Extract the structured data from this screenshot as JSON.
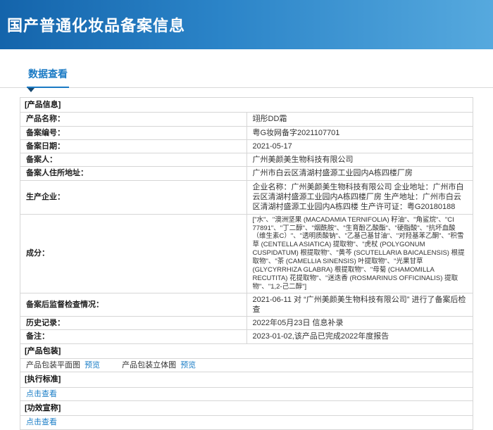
{
  "header": {
    "title": "国产普通化妆品备案信息"
  },
  "tabs": [
    {
      "label": "数据查看"
    }
  ],
  "product_info": {
    "section_title": "[产品信息]",
    "rows": [
      {
        "label": "产品名称：",
        "value": "翊彤DD霜"
      },
      {
        "label": "备案编号：",
        "value": "粤G妆网备字2021107701"
      },
      {
        "label": "备案日期：",
        "value": "2021-05-17"
      },
      {
        "label": "备案人：",
        "value": "广州美颜美生物科技有限公司"
      },
      {
        "label": "备案人住所地址：",
        "value": "广州市白云区清湖村盛源工业园内A栋四楼厂房"
      },
      {
        "label": "生产企业：",
        "value": "企业名称：广州美颜美生物科技有限公司 企业地址：广州市白云区清湖村盛源工业园内A栋四楼厂房 生产地址：广州市白云区清湖村盛源工业园内A栋四楼 生产许可证：粤G20180188"
      },
      {
        "label": "成分：",
        "value": "[\"水\"、\"澳洲坚果 (MACADAMIA TERNIFOLIA) 籽油\"、\"角鲨烷\"、\"CI 77891\"、\"丁二醇\"、\"烟酰胺\"、\"生育酚乙酸酯\"、\"硬脂酸\"、\"抗坏血酸（维生素C）\"、\"透明质酸钠\"、\"乙基己基甘油\"、\"对羟基苯乙酮\"、\"积雪草 (CENTELLA ASIATICA) 提取物\"、\"虎杖 (POLYGONUM CUSPIDATUM) 根提取物\"、\"黄芩 (SCUTELLARIA BAICALENSIS) 根提取物\"、\"茶 (CAMELLIA SINENSIS) 叶提取物\"、\"光果甘草 (GLYCYRRHIZA GLABRA) 根提取物\"、\"母菊 (CHAMOMILLA RECUTITA) 花提取物\"、\"迷迭香 (ROSMARINUS OFFICINALIS) 提取物\"、\"1,2-己二醇\"]"
      },
      {
        "label": "备案后监督检查情况：",
        "value": "2021-06-11 对 “广州美颜美生物科技有限公司” 进行了备案后检查"
      },
      {
        "label": "历史记录：",
        "value": "2022年05月23日 信息补录"
      },
      {
        "label": "备注：",
        "value": "2023-01-02,该产品已完成2022年度报告"
      }
    ]
  },
  "packaging": {
    "section_title": "[产品包装]",
    "flat_label": "产品包装平面图",
    "stereo_label": "产品包装立体图",
    "preview_label": "预览"
  },
  "standard": {
    "section_title": "[执行标准]",
    "link_label": "点击查看"
  },
  "efficacy": {
    "section_title": "[功效宣称]",
    "link_label": "点击查看"
  },
  "colors": {
    "accent": "#1b7ec7",
    "banner_start": "#1464ab",
    "banner_end": "#56a9de"
  }
}
